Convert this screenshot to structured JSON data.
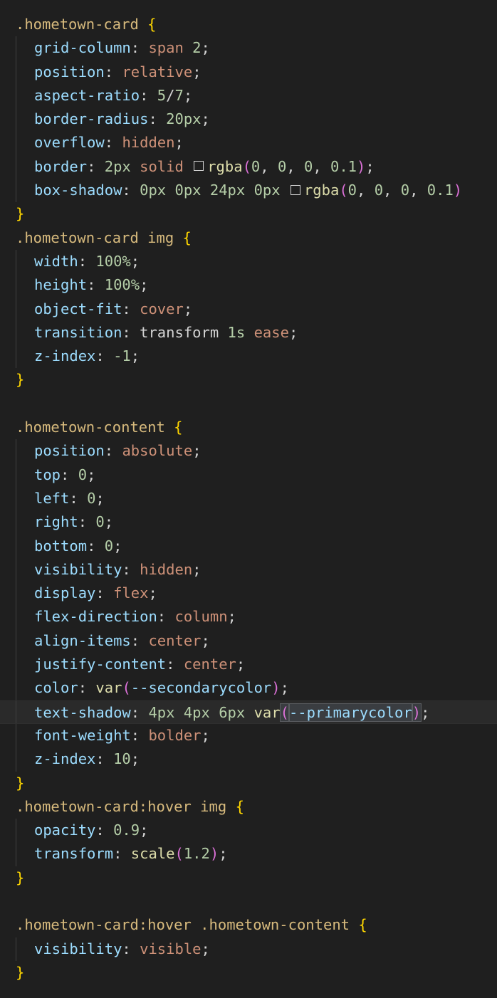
{
  "editor": {
    "language": "css",
    "colors": {
      "background": "#1f1f1f",
      "selector": "#d7ba7d",
      "brace": "#ffd700",
      "property": "#9cdcfe",
      "string_value": "#ce9178",
      "number": "#b5cea8",
      "function": "#dcdcaa",
      "paren": "#da70d6"
    },
    "lines": [
      {
        "tokens": [
          {
            "t": "sel",
            "v": ".hometown-card"
          },
          {
            "t": "punc",
            "v": " "
          },
          {
            "t": "brace",
            "v": "{"
          }
        ]
      },
      {
        "indent": 1,
        "tokens": [
          {
            "t": "prop",
            "v": "grid-column"
          },
          {
            "t": "punc",
            "v": ": "
          },
          {
            "t": "val",
            "v": "span"
          },
          {
            "t": "punc",
            "v": " "
          },
          {
            "t": "num",
            "v": "2"
          },
          {
            "t": "punc",
            "v": ";"
          }
        ]
      },
      {
        "indent": 1,
        "tokens": [
          {
            "t": "prop",
            "v": "position"
          },
          {
            "t": "punc",
            "v": ": "
          },
          {
            "t": "val",
            "v": "relative"
          },
          {
            "t": "punc",
            "v": ";"
          }
        ]
      },
      {
        "indent": 1,
        "tokens": [
          {
            "t": "prop",
            "v": "aspect-ratio"
          },
          {
            "t": "punc",
            "v": ": "
          },
          {
            "t": "num",
            "v": "5"
          },
          {
            "t": "punc",
            "v": "/"
          },
          {
            "t": "num",
            "v": "7"
          },
          {
            "t": "punc",
            "v": ";"
          }
        ]
      },
      {
        "indent": 1,
        "tokens": [
          {
            "t": "prop",
            "v": "border-radius"
          },
          {
            "t": "punc",
            "v": ": "
          },
          {
            "t": "num",
            "v": "20px"
          },
          {
            "t": "punc",
            "v": ";"
          }
        ]
      },
      {
        "indent": 1,
        "tokens": [
          {
            "t": "prop",
            "v": "overflow"
          },
          {
            "t": "punc",
            "v": ": "
          },
          {
            "t": "val",
            "v": "hidden"
          },
          {
            "t": "punc",
            "v": ";"
          }
        ]
      },
      {
        "indent": 1,
        "tokens": [
          {
            "t": "prop",
            "v": "border"
          },
          {
            "t": "punc",
            "v": ": "
          },
          {
            "t": "num",
            "v": "2px"
          },
          {
            "t": "punc",
            "v": " "
          },
          {
            "t": "val",
            "v": "solid"
          },
          {
            "t": "punc",
            "v": " "
          },
          {
            "t": "swatch",
            "v": ""
          },
          {
            "t": "fn",
            "v": "rgba"
          },
          {
            "t": "paren",
            "v": "("
          },
          {
            "t": "num",
            "v": "0"
          },
          {
            "t": "punc",
            "v": ", "
          },
          {
            "t": "num",
            "v": "0"
          },
          {
            "t": "punc",
            "v": ", "
          },
          {
            "t": "num",
            "v": "0"
          },
          {
            "t": "punc",
            "v": ", "
          },
          {
            "t": "num",
            "v": "0.1"
          },
          {
            "t": "paren",
            "v": ")"
          },
          {
            "t": "punc",
            "v": ";"
          }
        ]
      },
      {
        "indent": 1,
        "tokens": [
          {
            "t": "prop",
            "v": "box-shadow"
          },
          {
            "t": "punc",
            "v": ": "
          },
          {
            "t": "num",
            "v": "0px"
          },
          {
            "t": "punc",
            "v": " "
          },
          {
            "t": "num",
            "v": "0px"
          },
          {
            "t": "punc",
            "v": " "
          },
          {
            "t": "num",
            "v": "24px"
          },
          {
            "t": "punc",
            "v": " "
          },
          {
            "t": "num",
            "v": "0px"
          },
          {
            "t": "punc",
            "v": " "
          },
          {
            "t": "swatch",
            "v": ""
          },
          {
            "t": "fn",
            "v": "rgba"
          },
          {
            "t": "paren",
            "v": "("
          },
          {
            "t": "num",
            "v": "0"
          },
          {
            "t": "punc",
            "v": ", "
          },
          {
            "t": "num",
            "v": "0"
          },
          {
            "t": "punc",
            "v": ", "
          },
          {
            "t": "num",
            "v": "0"
          },
          {
            "t": "punc",
            "v": ", "
          },
          {
            "t": "num",
            "v": "0.1"
          },
          {
            "t": "paren",
            "v": ")"
          }
        ]
      },
      {
        "tokens": [
          {
            "t": "brace",
            "v": "}"
          }
        ]
      },
      {
        "tokens": [
          {
            "t": "sel",
            "v": ".hometown-card img"
          },
          {
            "t": "punc",
            "v": " "
          },
          {
            "t": "brace",
            "v": "{"
          }
        ]
      },
      {
        "indent": 1,
        "tokens": [
          {
            "t": "prop",
            "v": "width"
          },
          {
            "t": "punc",
            "v": ": "
          },
          {
            "t": "num",
            "v": "100%"
          },
          {
            "t": "punc",
            "v": ";"
          }
        ]
      },
      {
        "indent": 1,
        "tokens": [
          {
            "t": "prop",
            "v": "height"
          },
          {
            "t": "punc",
            "v": ": "
          },
          {
            "t": "num",
            "v": "100%"
          },
          {
            "t": "punc",
            "v": ";"
          }
        ]
      },
      {
        "indent": 1,
        "tokens": [
          {
            "t": "prop",
            "v": "object-fit"
          },
          {
            "t": "punc",
            "v": ": "
          },
          {
            "t": "val",
            "v": "cover"
          },
          {
            "t": "punc",
            "v": ";"
          }
        ]
      },
      {
        "indent": 1,
        "tokens": [
          {
            "t": "prop",
            "v": "transition"
          },
          {
            "t": "punc",
            "v": ": transform "
          },
          {
            "t": "num",
            "v": "1s"
          },
          {
            "t": "punc",
            "v": " "
          },
          {
            "t": "val",
            "v": "ease"
          },
          {
            "t": "punc",
            "v": ";"
          }
        ]
      },
      {
        "indent": 1,
        "tokens": [
          {
            "t": "prop",
            "v": "z-index"
          },
          {
            "t": "punc",
            "v": ": "
          },
          {
            "t": "num",
            "v": "-1"
          },
          {
            "t": "punc",
            "v": ";"
          }
        ]
      },
      {
        "tokens": [
          {
            "t": "brace",
            "v": "}"
          }
        ]
      },
      {
        "tokens": []
      },
      {
        "tokens": [
          {
            "t": "sel",
            "v": ".hometown-content"
          },
          {
            "t": "punc",
            "v": " "
          },
          {
            "t": "brace",
            "v": "{"
          }
        ]
      },
      {
        "indent": 1,
        "tokens": [
          {
            "t": "prop",
            "v": "position"
          },
          {
            "t": "punc",
            "v": ": "
          },
          {
            "t": "val",
            "v": "absolute"
          },
          {
            "t": "punc",
            "v": ";"
          }
        ]
      },
      {
        "indent": 1,
        "tokens": [
          {
            "t": "prop",
            "v": "top"
          },
          {
            "t": "punc",
            "v": ": "
          },
          {
            "t": "num",
            "v": "0"
          },
          {
            "t": "punc",
            "v": ";"
          }
        ]
      },
      {
        "indent": 1,
        "tokens": [
          {
            "t": "prop",
            "v": "left"
          },
          {
            "t": "punc",
            "v": ": "
          },
          {
            "t": "num",
            "v": "0"
          },
          {
            "t": "punc",
            "v": ";"
          }
        ]
      },
      {
        "indent": 1,
        "tokens": [
          {
            "t": "prop",
            "v": "right"
          },
          {
            "t": "punc",
            "v": ": "
          },
          {
            "t": "num",
            "v": "0"
          },
          {
            "t": "punc",
            "v": ";"
          }
        ]
      },
      {
        "indent": 1,
        "tokens": [
          {
            "t": "prop",
            "v": "bottom"
          },
          {
            "t": "punc",
            "v": ": "
          },
          {
            "t": "num",
            "v": "0"
          },
          {
            "t": "punc",
            "v": ";"
          }
        ]
      },
      {
        "indent": 1,
        "tokens": [
          {
            "t": "prop",
            "v": "visibility"
          },
          {
            "t": "punc",
            "v": ": "
          },
          {
            "t": "val",
            "v": "hidden"
          },
          {
            "t": "punc",
            "v": ";"
          }
        ]
      },
      {
        "indent": 1,
        "tokens": [
          {
            "t": "prop",
            "v": "display"
          },
          {
            "t": "punc",
            "v": ": "
          },
          {
            "t": "val",
            "v": "flex"
          },
          {
            "t": "punc",
            "v": ";"
          }
        ]
      },
      {
        "indent": 1,
        "tokens": [
          {
            "t": "prop",
            "v": "flex-direction"
          },
          {
            "t": "punc",
            "v": ": "
          },
          {
            "t": "val",
            "v": "column"
          },
          {
            "t": "punc",
            "v": ";"
          }
        ]
      },
      {
        "indent": 1,
        "tokens": [
          {
            "t": "prop",
            "v": "align-items"
          },
          {
            "t": "punc",
            "v": ": "
          },
          {
            "t": "val",
            "v": "center"
          },
          {
            "t": "punc",
            "v": ";"
          }
        ]
      },
      {
        "indent": 1,
        "tokens": [
          {
            "t": "prop",
            "v": "justify-content"
          },
          {
            "t": "punc",
            "v": ": "
          },
          {
            "t": "val",
            "v": "center"
          },
          {
            "t": "punc",
            "v": ";"
          }
        ]
      },
      {
        "indent": 1,
        "tokens": [
          {
            "t": "prop",
            "v": "color"
          },
          {
            "t": "punc",
            "v": ": "
          },
          {
            "t": "fn",
            "v": "var"
          },
          {
            "t": "paren",
            "v": "("
          },
          {
            "t": "var",
            "v": "--secondarycolor"
          },
          {
            "t": "paren",
            "v": ")"
          },
          {
            "t": "punc",
            "v": ";"
          }
        ]
      },
      {
        "indent": 1,
        "current": true,
        "tokens": [
          {
            "t": "prop",
            "v": "text-shadow"
          },
          {
            "t": "punc",
            "v": ": "
          },
          {
            "t": "num",
            "v": "4px"
          },
          {
            "t": "punc",
            "v": " "
          },
          {
            "t": "num",
            "v": "4px"
          },
          {
            "t": "punc",
            "v": " "
          },
          {
            "t": "num",
            "v": "6px"
          },
          {
            "t": "punc",
            "v": " "
          },
          {
            "t": "fn",
            "v": "var"
          },
          {
            "t": "paren hl",
            "v": "("
          },
          {
            "t": "var hl",
            "v": "--primarycolor"
          },
          {
            "t": "paren hl",
            "v": ")"
          },
          {
            "t": "punc",
            "v": ";"
          }
        ]
      },
      {
        "indent": 1,
        "tokens": [
          {
            "t": "prop",
            "v": "font-weight"
          },
          {
            "t": "punc",
            "v": ": "
          },
          {
            "t": "val",
            "v": "bolder"
          },
          {
            "t": "punc",
            "v": ";"
          }
        ]
      },
      {
        "indent": 1,
        "tokens": [
          {
            "t": "prop",
            "v": "z-index"
          },
          {
            "t": "punc",
            "v": ": "
          },
          {
            "t": "num",
            "v": "10"
          },
          {
            "t": "punc",
            "v": ";"
          }
        ]
      },
      {
        "tokens": [
          {
            "t": "brace",
            "v": "}"
          }
        ]
      },
      {
        "tokens": [
          {
            "t": "sel",
            "v": ".hometown-card:hover img"
          },
          {
            "t": "punc",
            "v": " "
          },
          {
            "t": "brace",
            "v": "{"
          }
        ]
      },
      {
        "indent": 1,
        "tokens": [
          {
            "t": "prop",
            "v": "opacity"
          },
          {
            "t": "punc",
            "v": ": "
          },
          {
            "t": "num",
            "v": "0.9"
          },
          {
            "t": "punc",
            "v": ";"
          }
        ]
      },
      {
        "indent": 1,
        "tokens": [
          {
            "t": "prop",
            "v": "transform"
          },
          {
            "t": "punc",
            "v": ": "
          },
          {
            "t": "fn",
            "v": "scale"
          },
          {
            "t": "paren",
            "v": "("
          },
          {
            "t": "num",
            "v": "1.2"
          },
          {
            "t": "paren",
            "v": ")"
          },
          {
            "t": "punc",
            "v": ";"
          }
        ]
      },
      {
        "tokens": [
          {
            "t": "brace",
            "v": "}"
          }
        ]
      },
      {
        "tokens": []
      },
      {
        "tokens": [
          {
            "t": "sel",
            "v": ".hometown-card:hover .hometown-content"
          },
          {
            "t": "punc",
            "v": " "
          },
          {
            "t": "brace",
            "v": "{"
          }
        ]
      },
      {
        "indent": 1,
        "tokens": [
          {
            "t": "prop",
            "v": "visibility"
          },
          {
            "t": "punc",
            "v": ": "
          },
          {
            "t": "val",
            "v": "visible"
          },
          {
            "t": "punc",
            "v": ";"
          }
        ]
      },
      {
        "tokens": [
          {
            "t": "brace",
            "v": "}"
          }
        ]
      }
    ]
  }
}
